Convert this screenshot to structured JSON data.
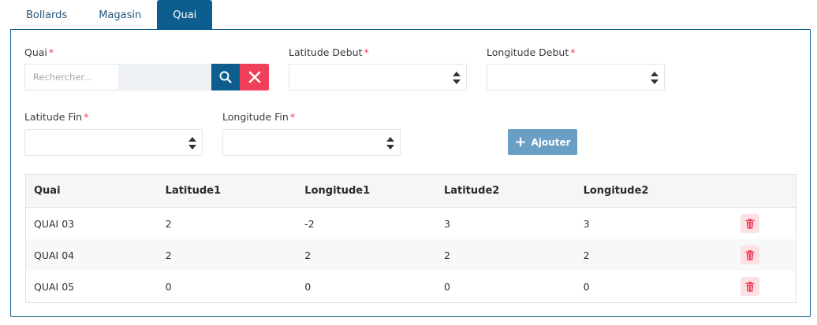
{
  "tabs": [
    {
      "label": "Bollards",
      "active": false
    },
    {
      "label": "Magasin",
      "active": false
    },
    {
      "label": "Quai",
      "active": true
    }
  ],
  "form": {
    "quai_label": "Quai",
    "search_placeholder": "Rechercher...",
    "lat_debut_label": "Latitude Debut",
    "lon_debut_label": "Longitude Debut",
    "lat_fin_label": "Latitude Fin",
    "lon_fin_label": "Longitude Fin",
    "required_mark": "*",
    "add_label": "Ajouter"
  },
  "table": {
    "headers": [
      "Quai",
      "Latitude1",
      "Longitude1",
      "Latitude2",
      "Longitude2"
    ],
    "rows": [
      {
        "quai": "QUAI 03",
        "lat1": "2",
        "lon1": "-2",
        "lat2": "3",
        "lon2": "3"
      },
      {
        "quai": "QUAI 04",
        "lat1": "2",
        "lon1": "2",
        "lat2": "2",
        "lon2": "2"
      },
      {
        "quai": "QUAI 05",
        "lat1": "0",
        "lon1": "0",
        "lat2": "0",
        "lon2": "0"
      }
    ]
  },
  "colors": {
    "primary": "#0d5e8f",
    "danger": "#ef4059",
    "add_button": "#6a9fc5"
  },
  "icons": {
    "search": "search-icon",
    "clear": "close-icon",
    "spinner": "spinner-arrows-icon",
    "add": "plus-icon",
    "delete": "trash-icon"
  }
}
